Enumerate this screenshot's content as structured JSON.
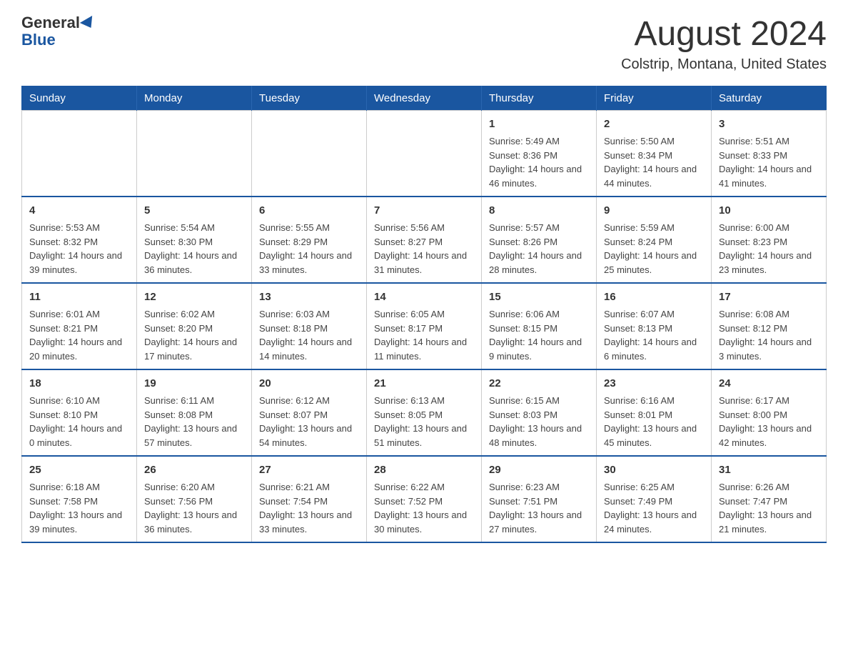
{
  "logo": {
    "general": "General",
    "blue": "Blue"
  },
  "title": "August 2024",
  "subtitle": "Colstrip, Montana, United States",
  "days_of_week": [
    "Sunday",
    "Monday",
    "Tuesday",
    "Wednesday",
    "Thursday",
    "Friday",
    "Saturday"
  ],
  "weeks": [
    [
      {
        "day": "",
        "info": ""
      },
      {
        "day": "",
        "info": ""
      },
      {
        "day": "",
        "info": ""
      },
      {
        "day": "",
        "info": ""
      },
      {
        "day": "1",
        "info": "Sunrise: 5:49 AM\nSunset: 8:36 PM\nDaylight: 14 hours and 46 minutes."
      },
      {
        "day": "2",
        "info": "Sunrise: 5:50 AM\nSunset: 8:34 PM\nDaylight: 14 hours and 44 minutes."
      },
      {
        "day": "3",
        "info": "Sunrise: 5:51 AM\nSunset: 8:33 PM\nDaylight: 14 hours and 41 minutes."
      }
    ],
    [
      {
        "day": "4",
        "info": "Sunrise: 5:53 AM\nSunset: 8:32 PM\nDaylight: 14 hours and 39 minutes."
      },
      {
        "day": "5",
        "info": "Sunrise: 5:54 AM\nSunset: 8:30 PM\nDaylight: 14 hours and 36 minutes."
      },
      {
        "day": "6",
        "info": "Sunrise: 5:55 AM\nSunset: 8:29 PM\nDaylight: 14 hours and 33 minutes."
      },
      {
        "day": "7",
        "info": "Sunrise: 5:56 AM\nSunset: 8:27 PM\nDaylight: 14 hours and 31 minutes."
      },
      {
        "day": "8",
        "info": "Sunrise: 5:57 AM\nSunset: 8:26 PM\nDaylight: 14 hours and 28 minutes."
      },
      {
        "day": "9",
        "info": "Sunrise: 5:59 AM\nSunset: 8:24 PM\nDaylight: 14 hours and 25 minutes."
      },
      {
        "day": "10",
        "info": "Sunrise: 6:00 AM\nSunset: 8:23 PM\nDaylight: 14 hours and 23 minutes."
      }
    ],
    [
      {
        "day": "11",
        "info": "Sunrise: 6:01 AM\nSunset: 8:21 PM\nDaylight: 14 hours and 20 minutes."
      },
      {
        "day": "12",
        "info": "Sunrise: 6:02 AM\nSunset: 8:20 PM\nDaylight: 14 hours and 17 minutes."
      },
      {
        "day": "13",
        "info": "Sunrise: 6:03 AM\nSunset: 8:18 PM\nDaylight: 14 hours and 14 minutes."
      },
      {
        "day": "14",
        "info": "Sunrise: 6:05 AM\nSunset: 8:17 PM\nDaylight: 14 hours and 11 minutes."
      },
      {
        "day": "15",
        "info": "Sunrise: 6:06 AM\nSunset: 8:15 PM\nDaylight: 14 hours and 9 minutes."
      },
      {
        "day": "16",
        "info": "Sunrise: 6:07 AM\nSunset: 8:13 PM\nDaylight: 14 hours and 6 minutes."
      },
      {
        "day": "17",
        "info": "Sunrise: 6:08 AM\nSunset: 8:12 PM\nDaylight: 14 hours and 3 minutes."
      }
    ],
    [
      {
        "day": "18",
        "info": "Sunrise: 6:10 AM\nSunset: 8:10 PM\nDaylight: 14 hours and 0 minutes."
      },
      {
        "day": "19",
        "info": "Sunrise: 6:11 AM\nSunset: 8:08 PM\nDaylight: 13 hours and 57 minutes."
      },
      {
        "day": "20",
        "info": "Sunrise: 6:12 AM\nSunset: 8:07 PM\nDaylight: 13 hours and 54 minutes."
      },
      {
        "day": "21",
        "info": "Sunrise: 6:13 AM\nSunset: 8:05 PM\nDaylight: 13 hours and 51 minutes."
      },
      {
        "day": "22",
        "info": "Sunrise: 6:15 AM\nSunset: 8:03 PM\nDaylight: 13 hours and 48 minutes."
      },
      {
        "day": "23",
        "info": "Sunrise: 6:16 AM\nSunset: 8:01 PM\nDaylight: 13 hours and 45 minutes."
      },
      {
        "day": "24",
        "info": "Sunrise: 6:17 AM\nSunset: 8:00 PM\nDaylight: 13 hours and 42 minutes."
      }
    ],
    [
      {
        "day": "25",
        "info": "Sunrise: 6:18 AM\nSunset: 7:58 PM\nDaylight: 13 hours and 39 minutes."
      },
      {
        "day": "26",
        "info": "Sunrise: 6:20 AM\nSunset: 7:56 PM\nDaylight: 13 hours and 36 minutes."
      },
      {
        "day": "27",
        "info": "Sunrise: 6:21 AM\nSunset: 7:54 PM\nDaylight: 13 hours and 33 minutes."
      },
      {
        "day": "28",
        "info": "Sunrise: 6:22 AM\nSunset: 7:52 PM\nDaylight: 13 hours and 30 minutes."
      },
      {
        "day": "29",
        "info": "Sunrise: 6:23 AM\nSunset: 7:51 PM\nDaylight: 13 hours and 27 minutes."
      },
      {
        "day": "30",
        "info": "Sunrise: 6:25 AM\nSunset: 7:49 PM\nDaylight: 13 hours and 24 minutes."
      },
      {
        "day": "31",
        "info": "Sunrise: 6:26 AM\nSunset: 7:47 PM\nDaylight: 13 hours and 21 minutes."
      }
    ]
  ]
}
